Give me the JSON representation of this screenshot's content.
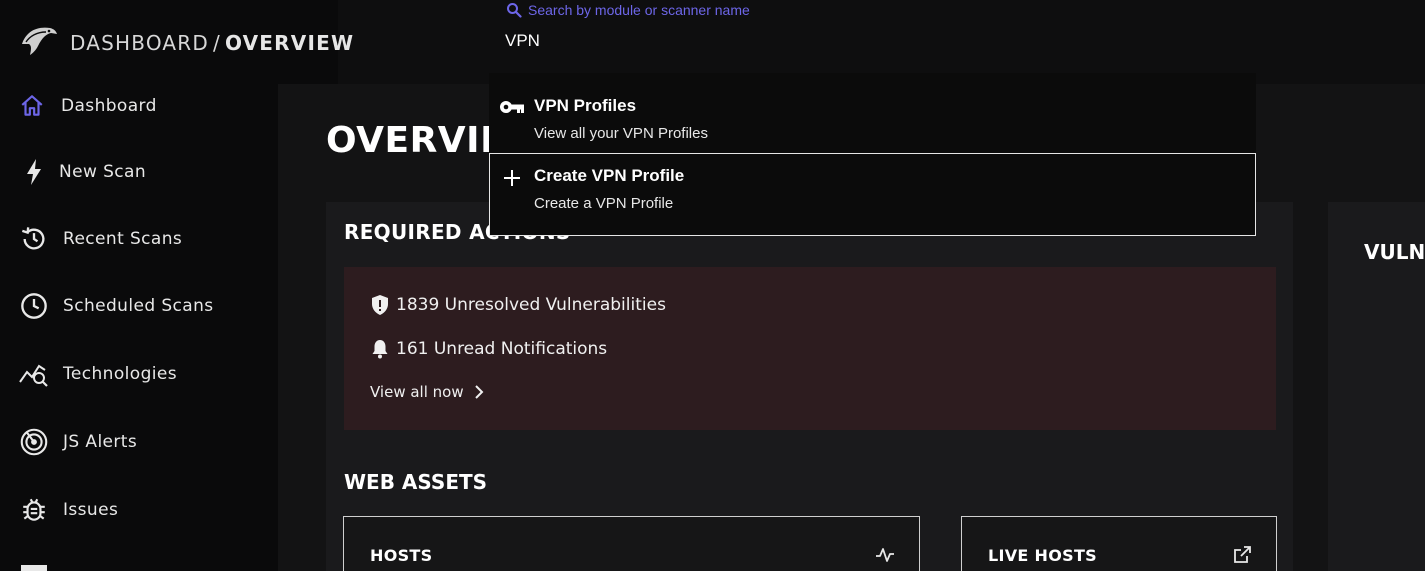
{
  "header": {
    "breadcrumb_parent": "DASHBOARD",
    "breadcrumb_separator": "/",
    "breadcrumb_current": "OVERVIEW"
  },
  "search": {
    "hint": "Search by module or scanner name",
    "value": "VPN",
    "results": [
      {
        "icon": "key-icon",
        "title": "VPN Profiles",
        "subtitle": "View all your VPN Profiles"
      },
      {
        "icon": "plus-icon",
        "title": "Create VPN Profile",
        "subtitle": "Create a VPN Profile"
      }
    ]
  },
  "sidebar": {
    "items": [
      {
        "icon": "home-icon",
        "label": "Dashboard"
      },
      {
        "icon": "lightning-icon",
        "label": "New Scan"
      },
      {
        "icon": "history-icon",
        "label": "Recent Scans"
      },
      {
        "icon": "clock-icon",
        "label": "Scheduled Scans"
      },
      {
        "icon": "chart-search-icon",
        "label": "Technologies"
      },
      {
        "icon": "radar-icon",
        "label": "JS Alerts"
      },
      {
        "icon": "bug-icon",
        "label": "Issues"
      }
    ]
  },
  "main": {
    "title": "OVERVIEW",
    "required_actions": {
      "title": "REQUIRED ACTIONS",
      "vulnerabilities": "1839 Unresolved Vulnerabilities",
      "notifications": "161 Unread Notifications",
      "link": "View all now"
    },
    "web_assets": {
      "title": "WEB ASSETS",
      "cards": [
        {
          "title": "HOSTS",
          "icon": "activity-icon"
        },
        {
          "title": "LIVE HOSTS",
          "icon": "external-link-icon"
        }
      ]
    },
    "right_panel_title": "VULNE"
  },
  "colors": {
    "accent": "#6d66e8",
    "alert_bg": "#2d1c1f",
    "panel_bg": "#1a1a1c"
  }
}
